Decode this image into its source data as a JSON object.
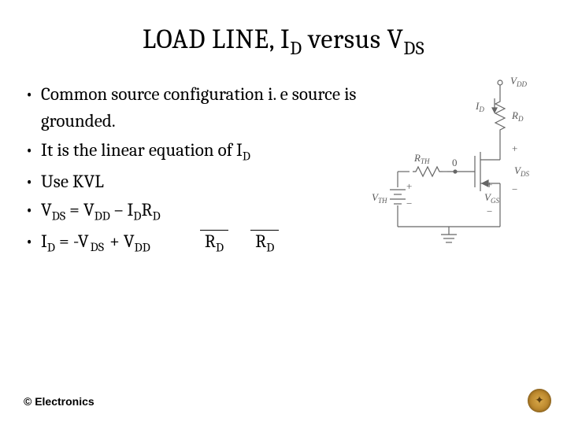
{
  "title": {
    "pre": "LOAD LINE, I",
    "sub1": "D",
    "mid": " versus V",
    "sub2": "DS"
  },
  "bullets": [
    {
      "text": "Common source configuration i. e source is grounded."
    },
    {
      "pre": "It is the linear equation of I",
      "sub": "D"
    },
    {
      "text": "Use KVL"
    },
    {
      "seg": [
        "V",
        "DS",
        " =  V",
        "DD",
        " – I",
        "D",
        "R",
        "D"
      ]
    },
    {
      "seg": [
        "I",
        "D",
        " = -V",
        "DS",
        " + V",
        "DD"
      ],
      "denom": [
        "R",
        "D",
        "R",
        "D"
      ]
    }
  ],
  "circuit": {
    "VDD": "V",
    "VDDsub": "DD",
    "ID": "I",
    "IDsub": "D",
    "RD": "R",
    "RDsub": "D",
    "RTH": "R",
    "RTHsub": "TH",
    "VTH": "V",
    "VTHsub": "TH",
    "VGS": "V",
    "VGSsub": "GS",
    "VDS": "V",
    "VDSsub": "DS",
    "zero": "0",
    "plus": "+",
    "minus": "−"
  },
  "footer": "© Electronics"
}
